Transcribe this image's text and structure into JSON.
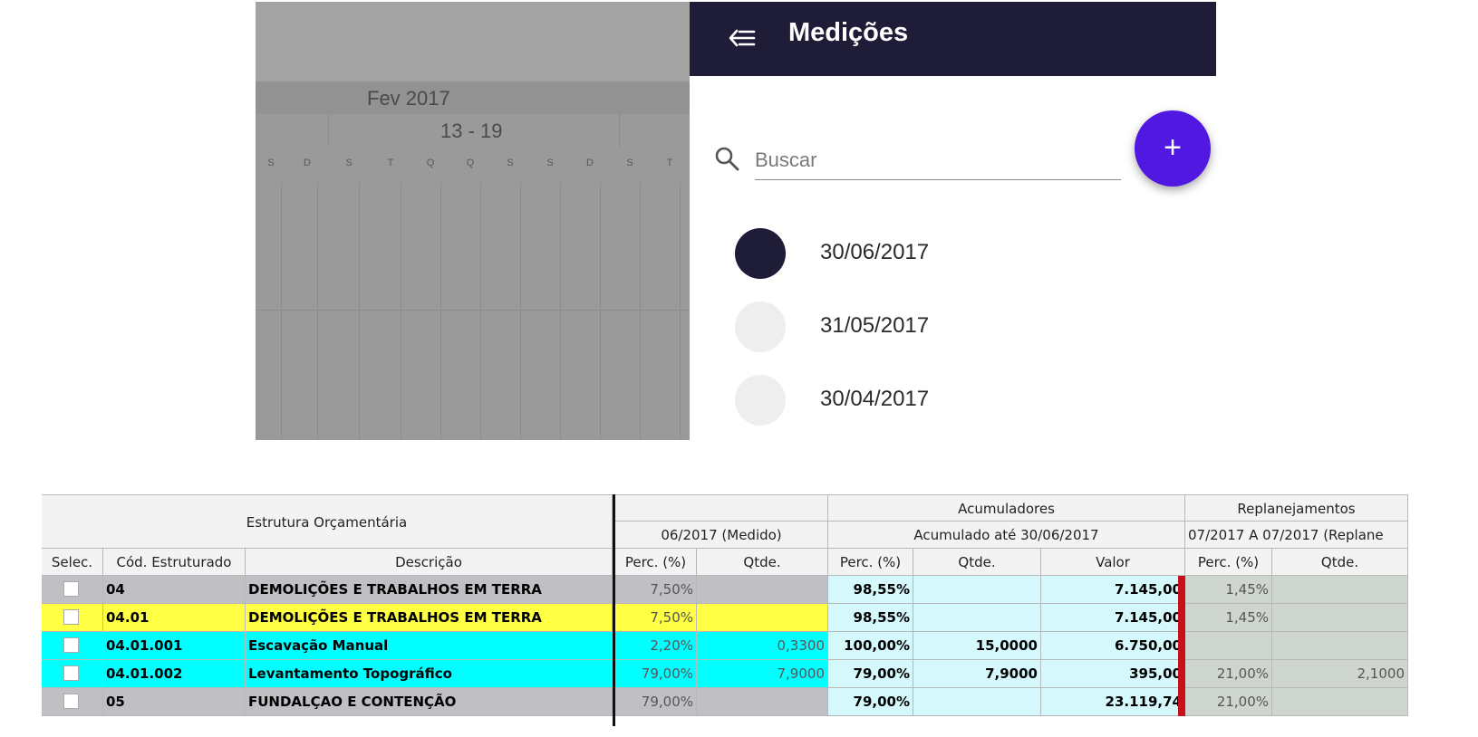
{
  "calendar": {
    "month": "Fev 2017",
    "week": "13 - 19",
    "day_letters": [
      "S",
      "D",
      "S",
      "T",
      "Q",
      "Q",
      "S",
      "S",
      "D",
      "S",
      "T"
    ]
  },
  "drawer": {
    "title": "Medições",
    "search_placeholder": "Buscar",
    "add_label": "+",
    "items": [
      {
        "label": "30/06/2017",
        "dot_color": "#1e1c37"
      },
      {
        "label": "31/05/2017",
        "dot_color": "#eeeeee"
      },
      {
        "label": "30/04/2017",
        "dot_color": "#eeeeee"
      }
    ]
  },
  "sheet": {
    "group_headers": {
      "estrutura": "Estrutura Orçamentária",
      "acumuladores": "Acumuladores",
      "replanejamentos": "Replanejamentos",
      "medido": "06/2017 (Medido)",
      "acumulado": "Acumulado até 30/06/2017",
      "replane": "07/2017 A 07/2017 (Replane"
    },
    "columns": [
      "Selec.",
      "Cód. Estruturado",
      "Descrição",
      "Perc. (%)",
      "Qtde.",
      "Perc. (%)",
      "Qtde.",
      "Valor",
      "Perc. (%)",
      "Qtde."
    ],
    "rows": [
      {
        "code": "04",
        "desc": "DEMOLIÇÕES E TRABALHOS EM TERRA",
        "m_perc": "7,50%",
        "m_qtde": "",
        "a_perc": "98,55%",
        "a_qtde": "",
        "a_valor": "7.145,00",
        "r_perc": "1,45%",
        "r_qtde": "",
        "bg": "#c0bfc4"
      },
      {
        "code": "04.01",
        "desc": "DEMOLIÇÕES E TRABALHOS EM TERRA",
        "m_perc": "7,50%",
        "m_qtde": "",
        "a_perc": "98,55%",
        "a_qtde": "",
        "a_valor": "7.145,00",
        "r_perc": "1,45%",
        "r_qtde": "",
        "bg": "#ffff44"
      },
      {
        "code": "04.01.001",
        "desc": "Escavação Manual",
        "m_perc": "2,20%",
        "m_qtde": "0,3300",
        "a_perc": "100,00%",
        "a_qtde": "15,0000",
        "a_valor": "6.750,00",
        "r_perc": "",
        "r_qtde": "",
        "bg": "#00ffff"
      },
      {
        "code": "04.01.002",
        "desc": "Levantamento Topográfico",
        "m_perc": "79,00%",
        "m_qtde": "7,9000",
        "a_perc": "79,00%",
        "a_qtde": "7,9000",
        "a_valor": "395,00",
        "r_perc": "21,00%",
        "r_qtde": "2,1000",
        "bg": "#00ffff"
      },
      {
        "code": "05",
        "desc": "FUNDALÇAO E CONTENÇÃO",
        "m_perc": "79,00%",
        "m_qtde": "",
        "a_perc": "79,00%",
        "a_qtde": "",
        "a_valor": "23.119,74",
        "r_perc": "21,00%",
        "r_qtde": "",
        "bg": "#c0bfc4"
      }
    ],
    "colors": {
      "acum_bg": "#d4f8fc",
      "repl_bg": "#cfd6cf",
      "marker": "#c8101a"
    }
  }
}
